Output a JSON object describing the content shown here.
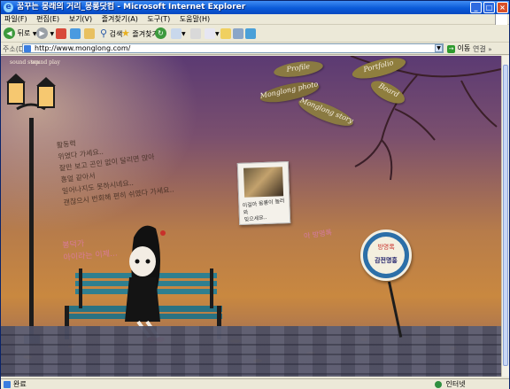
{
  "window": {
    "title": "꿈꾸는 몽래의 거리_몽롱닷컴 - Microsoft Internet Explorer",
    "controls": {
      "minimize": "_",
      "maximize": "□",
      "close": "×"
    }
  },
  "menu": {
    "items": [
      "파일(F)",
      "편집(E)",
      "보기(V)",
      "즐겨찾기(A)",
      "도구(T)",
      "도움말(H)"
    ]
  },
  "toolbar": {
    "back_label": "뒤로",
    "search_label": "검색",
    "favorites_label": "즐겨찾기"
  },
  "address": {
    "label": "주소(D)",
    "url": "http://www.monglong.com/",
    "go_label": "이동",
    "links_label": "연결"
  },
  "page": {
    "sound_stop": "sound stop",
    "sound_play": "sound play",
    "handwriting": [
      "활동력",
      "위였다 가세요..",
      "잘만 보고 곤인 없이 달리면 앉아",
      "흥얼 같아서",
      "일어나지도 못하시네요..",
      "괜찮으시 번회해 편히 쉬였다 가세요.."
    ],
    "pink_text": [
      "봉덕가",
      "아이라는 이제..."
    ],
    "nav_leaves": {
      "profile": "Profile",
      "portfolio": "Portfolio",
      "monglong_photo": "Monglong photo",
      "board": "Board",
      "monglong_story": "Monglong story"
    },
    "photo_caption": [
      "이걸아 몽롱이 놀러와",
      "잊으세요.."
    ],
    "guestbook_link": "아 방명록",
    "sign": {
      "top": "방명록",
      "middle": "감전명흥",
      "bottom": ""
    }
  },
  "status": {
    "text": "완료",
    "zone": "인터넷"
  },
  "colors": {
    "title_blue": "#0a5ad8",
    "leaf_olive": "#8a7a42",
    "sign_blue": "#2c6fa8",
    "pink": "#d97a98"
  }
}
